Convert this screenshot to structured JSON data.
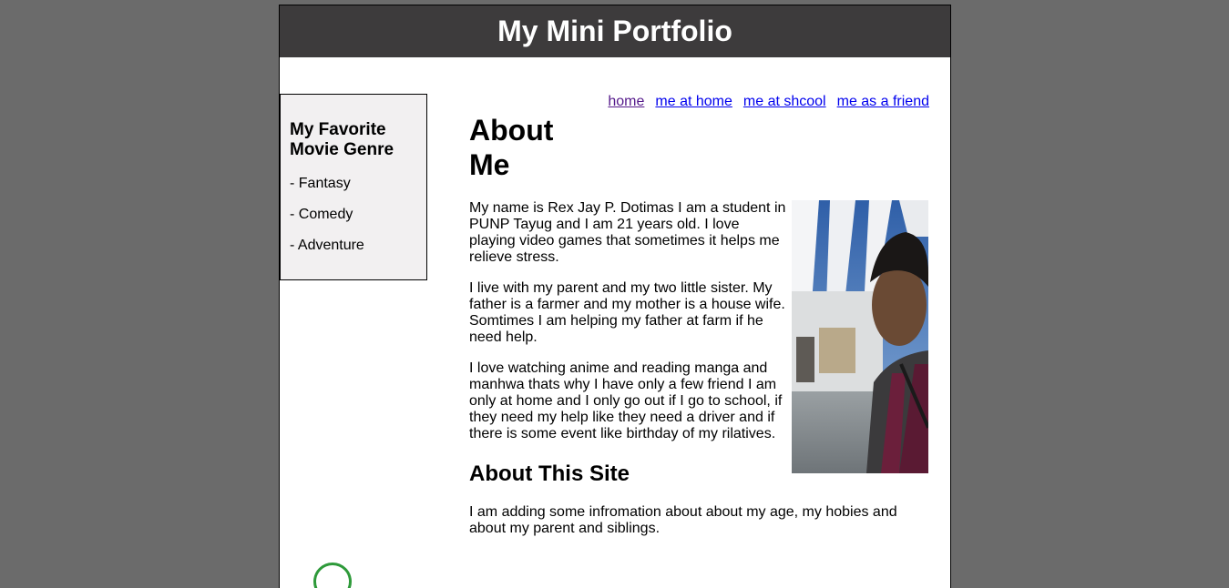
{
  "header": {
    "title": "My Mini Portfolio"
  },
  "sidebar": {
    "heading": "My Favorite Movie Genre",
    "items": [
      "- Fantasy",
      "- Comedy",
      "- Adventure"
    ]
  },
  "nav": {
    "links": [
      "home",
      "me at home",
      "me at shcool",
      "me as a friend"
    ]
  },
  "main": {
    "title": "About Me",
    "paragraphs": [
      "My name is Rex Jay P. Dotimas I am a student in PUNP Tayug and I am 21 years old. I love playing video games that sometimes it helps me relieve stress.",
      "I live with my parent and my two little sister. My father is a farmer and my mother is a house wife. Somtimes I am helping my father at farm if he need help.",
      "I love watching anime and reading manga and manhwa thats why I have only a few friend I am only at home and I only go out if I go to school, if they need my help like they need a driver and if there is some event like birthday of my rilatives."
    ],
    "site_heading": "About This Site",
    "site_paragraph": "I am adding some infromation about about my age, my hobies and about my parent and siblings."
  },
  "colors": {
    "header_bg": "#3d3b3c",
    "sidebar_bg": "#f2f0f1",
    "link": "#0000ee",
    "visited_link": "#551a8b",
    "page_bg": "#6b6b6b"
  }
}
